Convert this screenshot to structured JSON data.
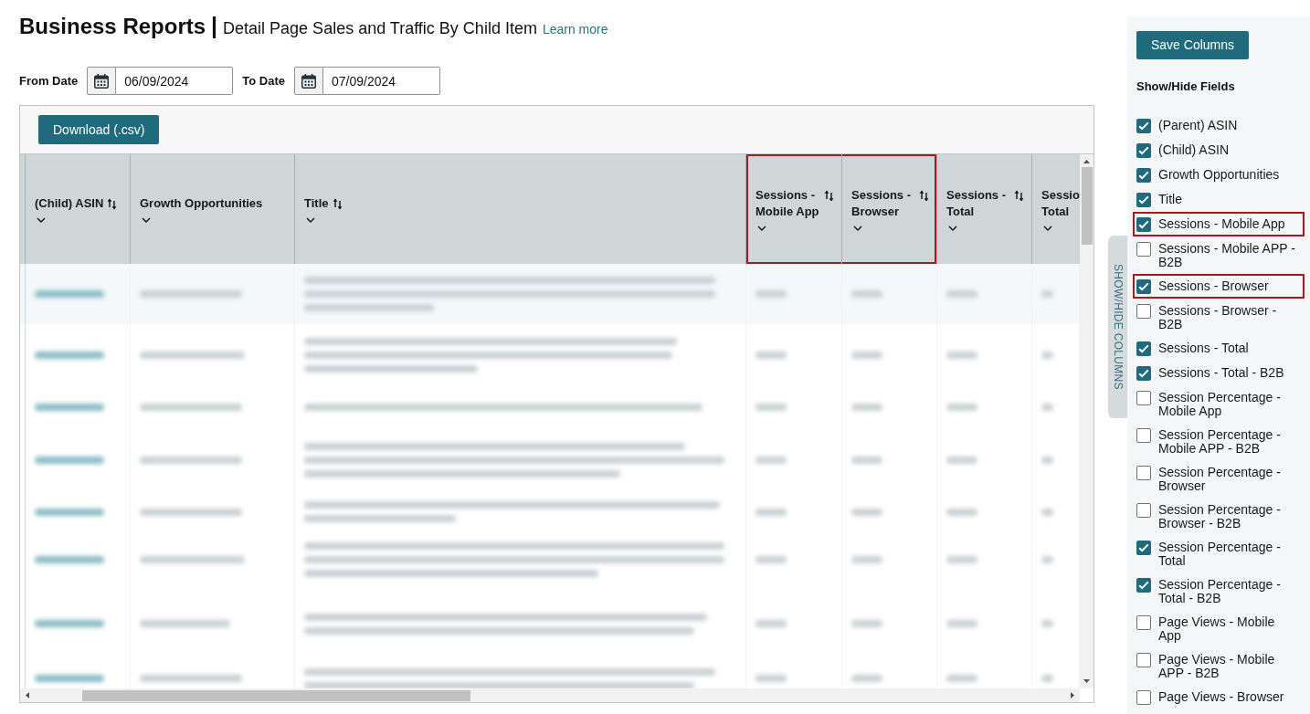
{
  "header": {
    "title": "Business Reports",
    "separator": "|",
    "subtitle": "Detail Page Sales and Traffic By Child Item",
    "learn_more": "Learn more"
  },
  "date_filters": [
    {
      "label": "From Date",
      "value": "06/09/2024"
    },
    {
      "label": "To Date",
      "value": "07/09/2024"
    }
  ],
  "table": {
    "download_button": "Download (.csv)",
    "columns": [
      {
        "label": "(Child) ASIN",
        "sortable": true,
        "highlighted": false
      },
      {
        "label": "Growth Opportunities",
        "sortable": false,
        "highlighted": false
      },
      {
        "label": "Title",
        "sortable": true,
        "highlighted": false
      },
      {
        "label": "Sessions - Mobile App",
        "sortable": true,
        "highlighted": true
      },
      {
        "label": "Sessions - Browser",
        "sortable": true,
        "highlighted": true
      },
      {
        "label": "Sessions - Total",
        "sortable": true,
        "highlighted": false
      },
      {
        "label": "Sessio Total",
        "sortable": false,
        "highlighted": false
      }
    ]
  },
  "side_tab": {
    "label": "SHOW/HIDE COLUMNS"
  },
  "fields_panel": {
    "save_button": "Save Columns",
    "heading": "Show/Hide Fields",
    "fields": [
      {
        "label": "(Parent) ASIN",
        "checked": true,
        "highlighted": false
      },
      {
        "label": "(Child) ASIN",
        "checked": true,
        "highlighted": false
      },
      {
        "label": "Growth Opportunities",
        "checked": true,
        "highlighted": false
      },
      {
        "label": "Title",
        "checked": true,
        "highlighted": false
      },
      {
        "label": "Sessions - Mobile App",
        "checked": true,
        "highlighted": true
      },
      {
        "label": "Sessions - Mobile APP - B2B",
        "checked": false,
        "highlighted": false
      },
      {
        "label": "Sessions - Browser",
        "checked": true,
        "highlighted": true
      },
      {
        "label": "Sessions - Browser - B2B",
        "checked": false,
        "highlighted": false
      },
      {
        "label": "Sessions - Total",
        "checked": true,
        "highlighted": false
      },
      {
        "label": "Sessions - Total - B2B",
        "checked": true,
        "highlighted": false
      },
      {
        "label": "Session Percentage - Mobile App",
        "checked": false,
        "highlighted": false
      },
      {
        "label": "Session Percentage - Mobile APP - B2B",
        "checked": false,
        "highlighted": false
      },
      {
        "label": "Session Percentage - Browser",
        "checked": false,
        "highlighted": false
      },
      {
        "label": "Session Percentage - Browser - B2B",
        "checked": false,
        "highlighted": false
      },
      {
        "label": "Session Percentage - Total",
        "checked": true,
        "highlighted": false
      },
      {
        "label": "Session Percentage - Total - B2B",
        "checked": true,
        "highlighted": false
      },
      {
        "label": "Page Views - Mobile App",
        "checked": false,
        "highlighted": false
      },
      {
        "label": "Page Views - Mobile APP - B2B",
        "checked": false,
        "highlighted": false
      },
      {
        "label": "Page Views - Browser",
        "checked": false,
        "highlighted": false
      }
    ]
  }
}
